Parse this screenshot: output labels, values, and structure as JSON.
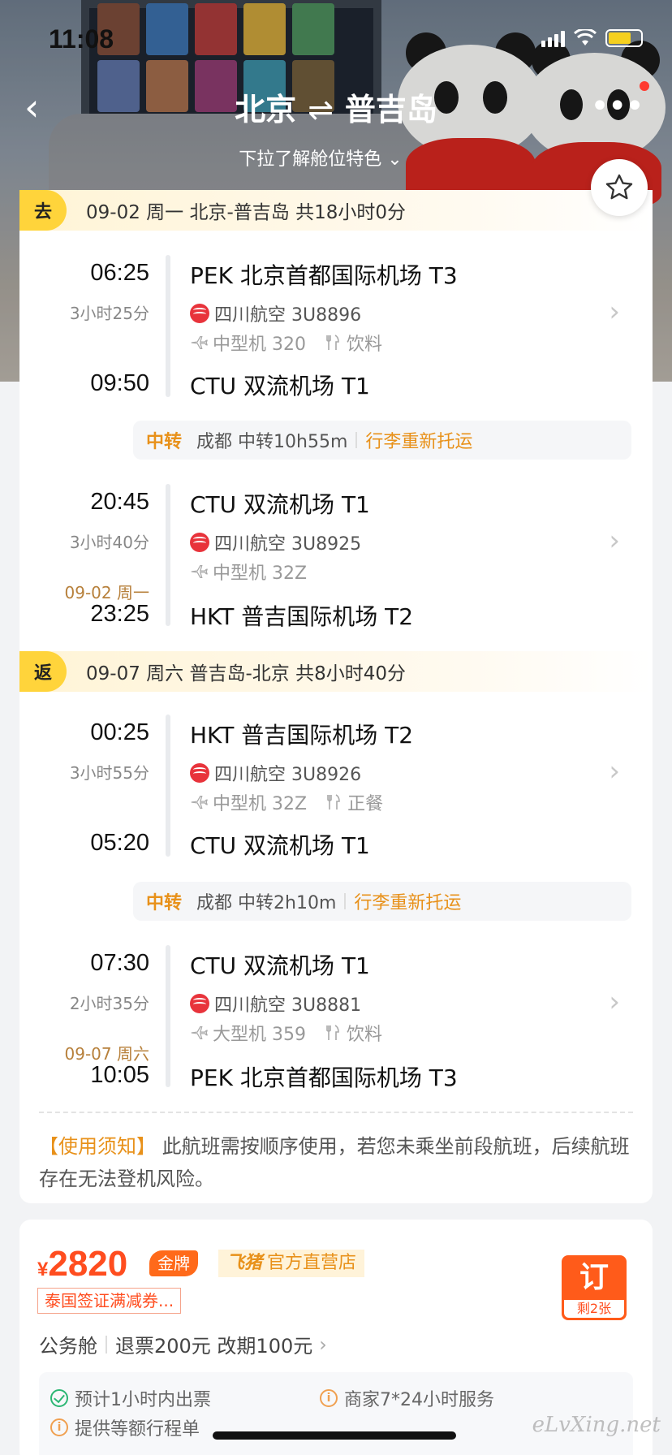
{
  "status_bar": {
    "time": "11:08"
  },
  "nav": {
    "origin": "北京",
    "arrow": "⇌",
    "destination": "普吉岛",
    "subtitle": "下拉了解舱位特色 ⌄"
  },
  "outbound": {
    "tag": "去",
    "summary": "09-02 周一 北京-普吉岛 共18小时0分",
    "legs": [
      {
        "dep_time": "06:25",
        "dep_airport": "PEK 北京首都国际机场 T3",
        "duration": "3小时25分",
        "airline": "四川航空 3U8896",
        "aircraft": "中型机 320",
        "meal": "饮料",
        "arr_time": "09:50",
        "arr_airport": "CTU 双流机场 T1"
      },
      {
        "dep_time": "20:45",
        "dep_airport": "CTU 双流机场 T1",
        "duration": "3小时40分",
        "airline": "四川航空 3U8925",
        "aircraft": "中型机 32Z",
        "arr_date": "09-02 周一",
        "arr_time": "23:25",
        "arr_airport": "HKT 普吉国际机场 T2"
      }
    ],
    "transfer": {
      "label": "中转",
      "city": "成都 中转10h55m",
      "baggage": "行李重新托运"
    }
  },
  "return": {
    "tag": "返",
    "summary": "09-07 周六 普吉岛-北京 共8小时40分",
    "legs": [
      {
        "dep_time": "00:25",
        "dep_airport": "HKT 普吉国际机场 T2",
        "duration": "3小时55分",
        "airline": "四川航空 3U8926",
        "aircraft": "中型机 32Z",
        "meal": "正餐",
        "arr_time": "05:20",
        "arr_airport": "CTU 双流机场 T1"
      },
      {
        "dep_time": "07:30",
        "dep_airport": "CTU 双流机场 T1",
        "duration": "2小时35分",
        "airline": "四川航空 3U8881",
        "aircraft": "大型机 359",
        "meal": "饮料",
        "arr_date": "09-07 周六",
        "arr_time": "10:05",
        "arr_airport": "PEK 北京首都国际机场 T3"
      }
    ],
    "transfer": {
      "label": "中转",
      "city": "成都 中转2h10m",
      "baggage": "行李重新托运"
    }
  },
  "notice": {
    "title": "【使用须知】",
    "text": "此航班需按顺序使用，若您未乘坐前段航班，后续航班存在无法登机风险。"
  },
  "offer": {
    "currency": "¥",
    "price": "2820",
    "badge": "金牌",
    "shop_brand": "飞猪",
    "shop_label": "官方直营店",
    "coupon": "泰国签证满减券...",
    "cabin": "公务舱",
    "refund": "退票200元 改期100元",
    "book_label": "订",
    "remaining": "剩2张",
    "services": [
      "预计1小时内出票",
      "商家7*24小时服务",
      "提供等额行程单"
    ]
  },
  "watermark": "eLvXing.net",
  "colors": {
    "accent": "#e8911a",
    "price": "#ff4d1f",
    "tag": "#ffd43b"
  }
}
